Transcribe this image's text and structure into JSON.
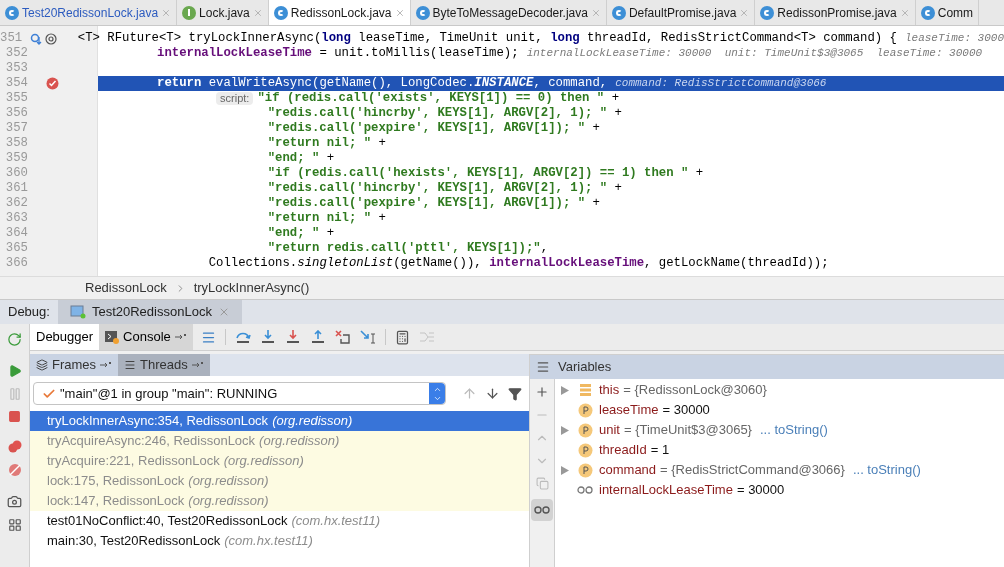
{
  "editor_tabs": [
    {
      "label": "Test20RedissonLock.java",
      "kind": "class",
      "selected": false,
      "color": "#2c5bbf"
    },
    {
      "label": "Lock.java",
      "kind": "interface",
      "selected": false,
      "color": "#1a1a1a"
    },
    {
      "label": "RedissonLock.java",
      "kind": "class",
      "selected": true,
      "color": "#1a1a1a"
    },
    {
      "label": "ByteToMessageDecoder.java",
      "kind": "class",
      "selected": false,
      "color": "#1a1a1a"
    },
    {
      "label": "DefaultPromise.java",
      "kind": "class",
      "selected": false,
      "color": "#1a1a1a"
    },
    {
      "label": "RedissonPromise.java",
      "kind": "class",
      "selected": false,
      "color": "#1a1a1a"
    },
    {
      "label": "Comm",
      "kind": "class",
      "selected": false,
      "color": "#1a1a1a"
    }
  ],
  "editor": {
    "lines": [
      {
        "number": "351",
        "kind": "declaration",
        "current": false,
        "implements": true,
        "breakpoint": false,
        "segments": [
          {
            "kind": "plain",
            "text": "<T> RFuture<T> tryLockInnerAsync("
          },
          {
            "kind": "keyword",
            "text": "long"
          },
          {
            "kind": "plain",
            "text": " leaseTime, TimeUnit unit, "
          },
          {
            "kind": "keyword",
            "text": "long"
          },
          {
            "kind": "plain",
            "text": " threadId, RedisStrictCommand<T> command) {"
          },
          {
            "kind": "hint",
            "text": "leaseTime: 3000"
          }
        ]
      },
      {
        "number": "352",
        "kind": "body",
        "current": false,
        "implements": false,
        "breakpoint": false,
        "segments": [
          {
            "kind": "field",
            "text": "internalLockLeaseTime"
          },
          {
            "kind": "plain",
            "text": " = unit.toMillis(leaseTime);"
          },
          {
            "kind": "hint",
            "text": "internalLockLeaseTime: 30000  unit: TimeUnit$3@3065  leaseTime: 30000"
          }
        ]
      },
      {
        "number": "353",
        "kind": "body",
        "current": false,
        "implements": false,
        "breakpoint": false
      },
      {
        "number": "354",
        "kind": "body",
        "current": true,
        "implements": false,
        "breakpoint": true,
        "segments": [
          {
            "kind": "keyword",
            "text": "return"
          },
          {
            "kind": "plain",
            "text": " evalWriteAsync(getName(), LongCodec."
          },
          {
            "kind": "static",
            "text": "INSTANCE"
          },
          {
            "kind": "plain",
            "text": ", command,"
          },
          {
            "kind": "hint",
            "text": "command: RedisStrictCommand@3066"
          }
        ]
      },
      {
        "number": "355",
        "kind": "argument",
        "current": false,
        "implements": false,
        "breakpoint": false,
        "segments": [
          {
            "kind": "badge",
            "text": "script:"
          },
          {
            "kind": "string",
            "text": "\"if (redis.call('exists', KEYS[1]) == 0) then \""
          },
          {
            "kind": "plain",
            "text": " +"
          }
        ]
      },
      {
        "number": "356",
        "kind": "continuation",
        "current": false,
        "implements": false,
        "breakpoint": false,
        "segments": [
          {
            "kind": "string",
            "text": "\"redis.call('hincrby', KEYS[1], ARGV[2], 1); \""
          },
          {
            "kind": "plain",
            "text": " +"
          }
        ]
      },
      {
        "number": "357",
        "kind": "continuation",
        "current": false,
        "implements": false,
        "breakpoint": false,
        "segments": [
          {
            "kind": "string",
            "text": "\"redis.call('pexpire', KEYS[1], ARGV[1]); \""
          },
          {
            "kind": "plain",
            "text": " +"
          }
        ]
      },
      {
        "number": "358",
        "kind": "continuation",
        "current": false,
        "implements": false,
        "breakpoint": false,
        "segments": [
          {
            "kind": "string",
            "text": "\"return nil; \""
          },
          {
            "kind": "plain",
            "text": " +"
          }
        ]
      },
      {
        "number": "359",
        "kind": "continuation",
        "current": false,
        "implements": false,
        "breakpoint": false,
        "segments": [
          {
            "kind": "string",
            "text": "\"end; \""
          },
          {
            "kind": "plain",
            "text": " +"
          }
        ]
      },
      {
        "number": "360",
        "kind": "continuation",
        "current": false,
        "implements": false,
        "breakpoint": false,
        "segments": [
          {
            "kind": "string",
            "text": "\"if (redis.call('hexists', KEYS[1], ARGV[2]) == 1) then \""
          },
          {
            "kind": "plain",
            "text": " +"
          }
        ]
      },
      {
        "number": "361",
        "kind": "continuation",
        "current": false,
        "implements": false,
        "breakpoint": false,
        "segments": [
          {
            "kind": "string",
            "text": "\"redis.call('hincrby', KEYS[1], ARGV[2], 1); \""
          },
          {
            "kind": "plain",
            "text": " +"
          }
        ]
      },
      {
        "number": "362",
        "kind": "continuation",
        "current": false,
        "implements": false,
        "breakpoint": false,
        "segments": [
          {
            "kind": "string",
            "text": "\"redis.call('pexpire', KEYS[1], ARGV[1]); \""
          },
          {
            "kind": "plain",
            "text": " +"
          }
        ]
      },
      {
        "number": "363",
        "kind": "continuation",
        "current": false,
        "implements": false,
        "breakpoint": false,
        "segments": [
          {
            "kind": "string",
            "text": "\"return nil; \""
          },
          {
            "kind": "plain",
            "text": " +"
          }
        ]
      },
      {
        "number": "364",
        "kind": "continuation",
        "current": false,
        "implements": false,
        "breakpoint": false,
        "segments": [
          {
            "kind": "string",
            "text": "\"end; \""
          },
          {
            "kind": "plain",
            "text": " +"
          }
        ]
      },
      {
        "number": "365",
        "kind": "continuation",
        "current": false,
        "implements": false,
        "breakpoint": false,
        "segments": [
          {
            "kind": "string",
            "text": "\"return redis.call('pttl', KEYS[1]);\""
          },
          {
            "kind": "plain",
            "text": ","
          }
        ]
      },
      {
        "number": "366",
        "kind": "call_argument",
        "current": false,
        "implements": false,
        "breakpoint": false,
        "segments": [
          {
            "kind": "plain",
            "text": "Collections."
          },
          {
            "kind": "italic",
            "text": "singletonList"
          },
          {
            "kind": "plain",
            "text": "(getName()), "
          },
          {
            "kind": "field",
            "text": "internalLockLeaseTime"
          },
          {
            "kind": "plain",
            "text": ", getLockName(threadId));"
          }
        ]
      }
    ]
  },
  "breadcrumb": [
    "RedissonLock",
    "tryLockInnerAsync()"
  ],
  "debug_bar": {
    "label": "Debug:",
    "session": "Test20RedissonLock"
  },
  "debug_tabs": [
    {
      "label": "Debugger",
      "selected": true,
      "pinnable": false
    },
    {
      "label": "Console",
      "selected": false,
      "pinnable": true
    }
  ],
  "frames_tabs": [
    {
      "label": "Frames",
      "selected": true
    },
    {
      "label": "Threads",
      "selected": false
    }
  ],
  "thread_selector": "\"main\"@1 in group \"main\": RUNNING",
  "frames": [
    {
      "method": "tryLockInnerAsync:354, RedissonLock",
      "package": "(org.redisson)",
      "selected": true,
      "library": false
    },
    {
      "method": "tryAcquireAsync:246, RedissonLock",
      "package": "(org.redisson)",
      "selected": false,
      "library": true
    },
    {
      "method": "tryAcquire:221, RedissonLock",
      "package": "(org.redisson)",
      "selected": false,
      "library": true
    },
    {
      "method": "lock:175, RedissonLock",
      "package": "(org.redisson)",
      "selected": false,
      "library": true
    },
    {
      "method": "lock:147, RedissonLock",
      "package": "(org.redisson)",
      "selected": false,
      "library": true
    },
    {
      "method": "test01NoConflict:40, Test20RedissonLock",
      "package": "(com.hx.test11)",
      "selected": false,
      "library": false
    },
    {
      "method": "main:30, Test20RedissonLock",
      "package": "(com.hx.test11)",
      "selected": false,
      "library": false
    }
  ],
  "variables_title": "Variables",
  "variables": [
    {
      "kind": "object",
      "expandable": true,
      "name": "this",
      "value": "= {RedissonLock@3060}"
    },
    {
      "kind": "param",
      "expandable": false,
      "name": "leaseTime",
      "value": "= 30000"
    },
    {
      "kind": "param",
      "expandable": true,
      "name": "unit",
      "value": "= {TimeUnit$3@3065}",
      "link": "... toString()"
    },
    {
      "kind": "param",
      "expandable": false,
      "name": "threadId",
      "value": "= 1"
    },
    {
      "kind": "param",
      "expandable": true,
      "name": "command",
      "value": "= {RedisStrictCommand@3066}",
      "link": "... toString()"
    },
    {
      "kind": "watch",
      "expandable": false,
      "name": "internalLockLeaseTime",
      "value": "= 30000"
    }
  ]
}
